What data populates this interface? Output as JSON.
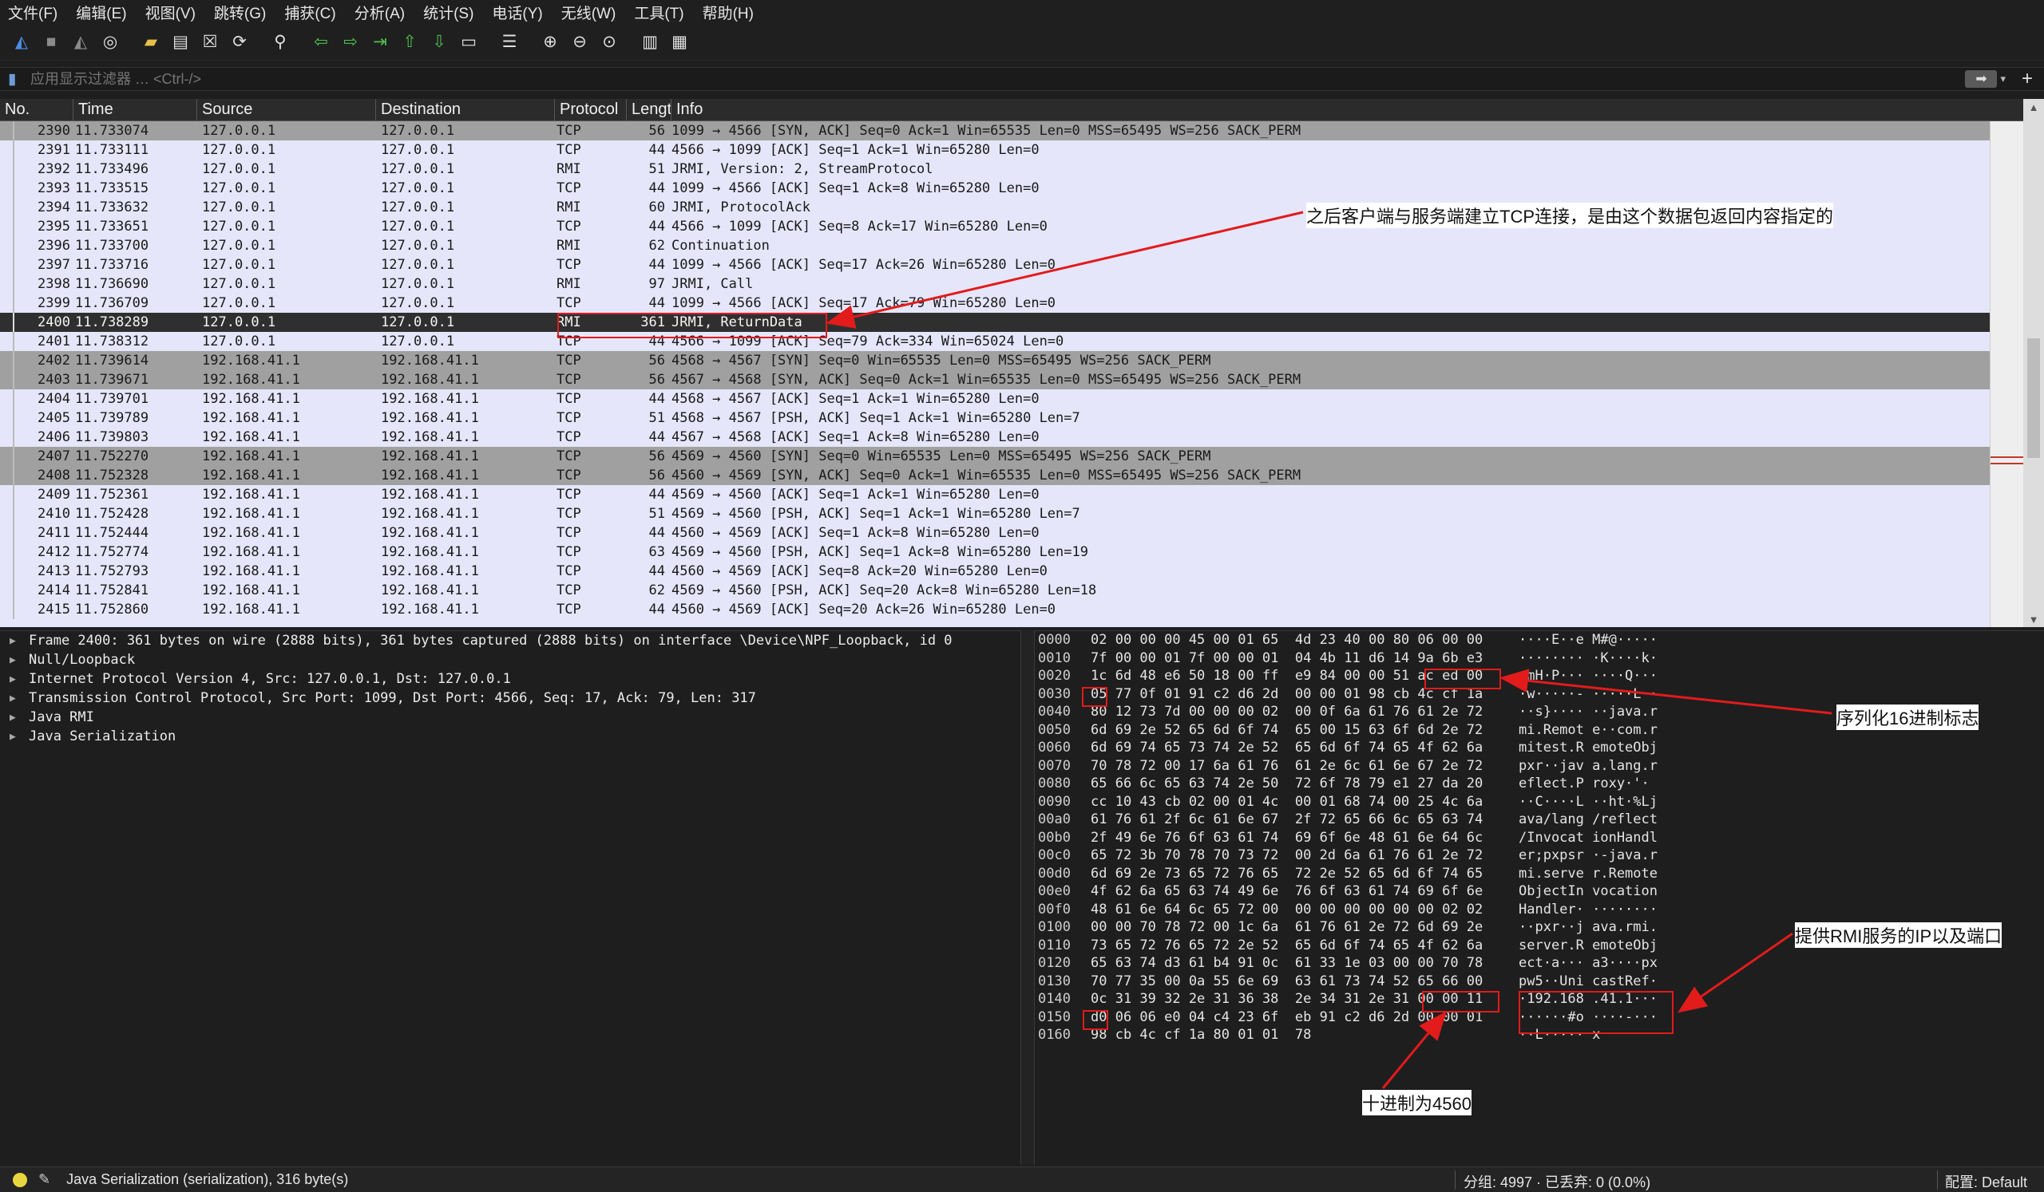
{
  "menu": [
    "文件(F)",
    "编辑(E)",
    "视图(V)",
    "跳转(G)",
    "捕获(C)",
    "分析(A)",
    "统计(S)",
    "电话(Y)",
    "无线(W)",
    "工具(T)",
    "帮助(H)"
  ],
  "toolbar": {
    "icons": [
      {
        "name": "shark-fin-start-icon",
        "glyph": "◭",
        "color": "#4b8de0"
      },
      {
        "name": "stop-capture-icon",
        "glyph": "■",
        "color": "#8a8a8a"
      },
      {
        "name": "restart-capture-icon",
        "glyph": "◭",
        "color": "#8a8a8a"
      },
      {
        "name": "capture-options-icon",
        "glyph": "◎",
        "color": "#e0e0e0"
      },
      {
        "name": "open-file-icon",
        "glyph": "▰",
        "color": "#e8c048"
      },
      {
        "name": "save-file-icon",
        "glyph": "▤",
        "color": "#e0e0e0"
      },
      {
        "name": "close-file-icon",
        "glyph": "☒",
        "color": "#e0e0e0"
      },
      {
        "name": "reload-file-icon",
        "glyph": "⟳",
        "color": "#e0e0e0"
      },
      {
        "name": "find-packet-icon",
        "glyph": "⚲",
        "color": "#e0e0e0"
      },
      {
        "name": "go-back-icon",
        "glyph": "⇦",
        "color": "#4fc04f"
      },
      {
        "name": "go-forward-icon",
        "glyph": "⇨",
        "color": "#4fc04f"
      },
      {
        "name": "go-to-packet-icon",
        "glyph": "⇥",
        "color": "#4fc04f"
      },
      {
        "name": "first-packet-icon",
        "glyph": "⇧",
        "color": "#4fc04f"
      },
      {
        "name": "last-packet-icon",
        "glyph": "⇩",
        "color": "#4fc04f"
      },
      {
        "name": "auto-scroll-icon",
        "glyph": "▭",
        "color": "#e0e0e0"
      },
      {
        "name": "colorize-icon",
        "glyph": "☰",
        "color": "#e0e0e0"
      },
      {
        "name": "zoom-in-icon",
        "glyph": "⊕",
        "color": "#e0e0e0"
      },
      {
        "name": "zoom-out-icon",
        "glyph": "⊖",
        "color": "#e0e0e0"
      },
      {
        "name": "zoom-normal-icon",
        "glyph": "⊙",
        "color": "#e0e0e0"
      },
      {
        "name": "resize-columns-icon",
        "glyph": "▥",
        "color": "#e0e0e0"
      },
      {
        "name": "layout-icon",
        "glyph": "▦",
        "color": "#e0e0e0"
      }
    ]
  },
  "filter": {
    "placeholder": "应用显示过滤器 … <Ctrl-/>",
    "apply_glyph": "➡",
    "dropdown_glyph": "▾",
    "add_glyph": "+"
  },
  "packet_list": {
    "columns": [
      "No.",
      "Time",
      "Source",
      "Destination",
      "Protocol",
      "Length",
      "Info"
    ],
    "rows": [
      {
        "no": "2390",
        "time": "11.733074",
        "src": "127.0.0.1",
        "dst": "127.0.0.1",
        "proto": "TCP",
        "len": "56",
        "info": "1099 → 4566 [SYN, ACK] Seq=0 Ack=1 Win=65535 Len=0 MSS=65495 WS=256 SACK_PERM",
        "style": "syn"
      },
      {
        "no": "2391",
        "time": "11.733111",
        "src": "127.0.0.1",
        "dst": "127.0.0.1",
        "proto": "TCP",
        "len": "44",
        "info": "4566 → 1099 [ACK] Seq=1 Ack=1 Win=65280 Len=0",
        "style": ""
      },
      {
        "no": "2392",
        "time": "11.733496",
        "src": "127.0.0.1",
        "dst": "127.0.0.1",
        "proto": "RMI",
        "len": "51",
        "info": "JRMI, Version: 2, StreamProtocol",
        "style": ""
      },
      {
        "no": "2393",
        "time": "11.733515",
        "src": "127.0.0.1",
        "dst": "127.0.0.1",
        "proto": "TCP",
        "len": "44",
        "info": "1099 → 4566 [ACK] Seq=1 Ack=8 Win=65280 Len=0",
        "style": ""
      },
      {
        "no": "2394",
        "time": "11.733632",
        "src": "127.0.0.1",
        "dst": "127.0.0.1",
        "proto": "RMI",
        "len": "60",
        "info": "JRMI, ProtocolAck",
        "style": ""
      },
      {
        "no": "2395",
        "time": "11.733651",
        "src": "127.0.0.1",
        "dst": "127.0.0.1",
        "proto": "TCP",
        "len": "44",
        "info": "4566 → 1099 [ACK] Seq=8 Ack=17 Win=65280 Len=0",
        "style": ""
      },
      {
        "no": "2396",
        "time": "11.733700",
        "src": "127.0.0.1",
        "dst": "127.0.0.1",
        "proto": "RMI",
        "len": "62",
        "info": "Continuation",
        "style": ""
      },
      {
        "no": "2397",
        "time": "11.733716",
        "src": "127.0.0.1",
        "dst": "127.0.0.1",
        "proto": "TCP",
        "len": "44",
        "info": "1099 → 4566 [ACK] Seq=17 Ack=26 Win=65280 Len=0",
        "style": ""
      },
      {
        "no": "2398",
        "time": "11.736690",
        "src": "127.0.0.1",
        "dst": "127.0.0.1",
        "proto": "RMI",
        "len": "97",
        "info": "JRMI, Call",
        "style": ""
      },
      {
        "no": "2399",
        "time": "11.736709",
        "src": "127.0.0.1",
        "dst": "127.0.0.1",
        "proto": "TCP",
        "len": "44",
        "info": "1099 → 4566 [ACK] Seq=17 Ack=79 Win=65280 Len=0",
        "style": ""
      },
      {
        "no": "2400",
        "time": "11.738289",
        "src": "127.0.0.1",
        "dst": "127.0.0.1",
        "proto": "RMI",
        "len": "361",
        "info": "JRMI, ReturnData",
        "style": "sel"
      },
      {
        "no": "2401",
        "time": "11.738312",
        "src": "127.0.0.1",
        "dst": "127.0.0.1",
        "proto": "TCP",
        "len": "44",
        "info": "4566 → 1099 [ACK] Seq=79 Ack=334 Win=65024 Len=0",
        "style": ""
      },
      {
        "no": "2402",
        "time": "11.739614",
        "src": "192.168.41.1",
        "dst": "192.168.41.1",
        "proto": "TCP",
        "len": "56",
        "info": "4568 → 4567 [SYN] Seq=0 Win=65535 Len=0 MSS=65495 WS=256 SACK_PERM",
        "style": "syn"
      },
      {
        "no": "2403",
        "time": "11.739671",
        "src": "192.168.41.1",
        "dst": "192.168.41.1",
        "proto": "TCP",
        "len": "56",
        "info": "4567 → 4568 [SYN, ACK] Seq=0 Ack=1 Win=65535 Len=0 MSS=65495 WS=256 SACK_PERM",
        "style": "syn"
      },
      {
        "no": "2404",
        "time": "11.739701",
        "src": "192.168.41.1",
        "dst": "192.168.41.1",
        "proto": "TCP",
        "len": "44",
        "info": "4568 → 4567 [ACK] Seq=1 Ack=1 Win=65280 Len=0",
        "style": ""
      },
      {
        "no": "2405",
        "time": "11.739789",
        "src": "192.168.41.1",
        "dst": "192.168.41.1",
        "proto": "TCP",
        "len": "51",
        "info": "4568 → 4567 [PSH, ACK] Seq=1 Ack=1 Win=65280 Len=7",
        "style": ""
      },
      {
        "no": "2406",
        "time": "11.739803",
        "src": "192.168.41.1",
        "dst": "192.168.41.1",
        "proto": "TCP",
        "len": "44",
        "info": "4567 → 4568 [ACK] Seq=1 Ack=8 Win=65280 Len=0",
        "style": ""
      },
      {
        "no": "2407",
        "time": "11.752270",
        "src": "192.168.41.1",
        "dst": "192.168.41.1",
        "proto": "TCP",
        "len": "56",
        "info": "4569 → 4560 [SYN] Seq=0 Win=65535 Len=0 MSS=65495 WS=256 SACK_PERM",
        "style": "syn"
      },
      {
        "no": "2408",
        "time": "11.752328",
        "src": "192.168.41.1",
        "dst": "192.168.41.1",
        "proto": "TCP",
        "len": "56",
        "info": "4560 → 4569 [SYN, ACK] Seq=0 Ack=1 Win=65535 Len=0 MSS=65495 WS=256 SACK_PERM",
        "style": "syn"
      },
      {
        "no": "2409",
        "time": "11.752361",
        "src": "192.168.41.1",
        "dst": "192.168.41.1",
        "proto": "TCP",
        "len": "44",
        "info": "4569 → 4560 [ACK] Seq=1 Ack=1 Win=65280 Len=0",
        "style": ""
      },
      {
        "no": "2410",
        "time": "11.752428",
        "src": "192.168.41.1",
        "dst": "192.168.41.1",
        "proto": "TCP",
        "len": "51",
        "info": "4569 → 4560 [PSH, ACK] Seq=1 Ack=1 Win=65280 Len=7",
        "style": ""
      },
      {
        "no": "2411",
        "time": "11.752444",
        "src": "192.168.41.1",
        "dst": "192.168.41.1",
        "proto": "TCP",
        "len": "44",
        "info": "4560 → 4569 [ACK] Seq=1 Ack=8 Win=65280 Len=0",
        "style": ""
      },
      {
        "no": "2412",
        "time": "11.752774",
        "src": "192.168.41.1",
        "dst": "192.168.41.1",
        "proto": "TCP",
        "len": "63",
        "info": "4569 → 4560 [PSH, ACK] Seq=1 Ack=8 Win=65280 Len=19",
        "style": ""
      },
      {
        "no": "2413",
        "time": "11.752793",
        "src": "192.168.41.1",
        "dst": "192.168.41.1",
        "proto": "TCP",
        "len": "44",
        "info": "4560 → 4569 [ACK] Seq=8 Ack=20 Win=65280 Len=0",
        "style": ""
      },
      {
        "no": "2414",
        "time": "11.752841",
        "src": "192.168.41.1",
        "dst": "192.168.41.1",
        "proto": "TCP",
        "len": "62",
        "info": "4569 → 4560 [PSH, ACK] Seq=20 Ack=8 Win=65280 Len=18",
        "style": ""
      },
      {
        "no": "2415",
        "time": "11.752860",
        "src": "192.168.41.1",
        "dst": "192.168.41.1",
        "proto": "TCP",
        "len": "44",
        "info": "4560 → 4569 [ACK] Seq=20 Ack=26 Win=65280 Len=0",
        "style": ""
      }
    ]
  },
  "details": [
    "Frame 2400: 361 bytes on wire (2888 bits), 361 bytes captured (2888 bits) on interface \\Device\\NPF_Loopback, id 0",
    "Null/Loopback",
    "Internet Protocol Version 4, Src: 127.0.0.1, Dst: 127.0.0.1",
    "Transmission Control Protocol, Src Port: 1099, Dst Port: 4566, Seq: 17, Ack: 79, Len: 317",
    "Java RMI",
    "Java Serialization"
  ],
  "hex": [
    {
      "off": "0000",
      "bytes": "02 00 00 00 45 00 01 65  4d 23 40 00 80 06 00 00",
      "ascii": "····E··e M#@·····"
    },
    {
      "off": "0010",
      "bytes": "7f 00 00 01 7f 00 00 01  04 4b 11 d6 14 9a 6b e3",
      "ascii": "········ ·K····k·"
    },
    {
      "off": "0020",
      "bytes": "1c 6d 48 e6 50 18 00 ff  e9 84 00 00 51 ac ed 00",
      "ascii": "·mH·P··· ····Q···"
    },
    {
      "off": "0030",
      "bytes": "05 77 0f 01 91 c2 d6 2d  00 00 01 98 cb 4c cf 1a",
      "ascii": "·w·····- ·····L··"
    },
    {
      "off": "0040",
      "bytes": "80 12 73 7d 00 00 00 02  00 0f 6a 61 76 61 2e 72",
      "ascii": "··s}···· ··java.r"
    },
    {
      "off": "0050",
      "bytes": "6d 69 2e 52 65 6d 6f 74  65 00 15 63 6f 6d 2e 72",
      "ascii": "mi.Remot e··com.r"
    },
    {
      "off": "0060",
      "bytes": "6d 69 74 65 73 74 2e 52  65 6d 6f 74 65 4f 62 6a",
      "ascii": "mitest.R emoteObj"
    },
    {
      "off": "0070",
      "bytes": "70 78 72 00 17 6a 61 76  61 2e 6c 61 6e 67 2e 72",
      "ascii": "pxr··jav a.lang.r"
    },
    {
      "off": "0080",
      "bytes": "65 66 6c 65 63 74 2e 50  72 6f 78 79 e1 27 da 20",
      "ascii": "eflect.P roxy·'· "
    },
    {
      "off": "0090",
      "bytes": "cc 10 43 cb 02 00 01 4c  00 01 68 74 00 25 4c 6a",
      "ascii": "··C····L ··ht·%Lj"
    },
    {
      "off": "00a0",
      "bytes": "61 76 61 2f 6c 61 6e 67  2f 72 65 66 6c 65 63 74",
      "ascii": "ava/lang /reflect"
    },
    {
      "off": "00b0",
      "bytes": "2f 49 6e 76 6f 63 61 74  69 6f 6e 48 61 6e 64 6c",
      "ascii": "/Invocat ionHandl"
    },
    {
      "off": "00c0",
      "bytes": "65 72 3b 70 78 70 73 72  00 2d 6a 61 76 61 2e 72",
      "ascii": "er;pxpsr ·-java.r"
    },
    {
      "off": "00d0",
      "bytes": "6d 69 2e 73 65 72 76 65  72 2e 52 65 6d 6f 74 65",
      "ascii": "mi.serve r.Remote"
    },
    {
      "off": "00e0",
      "bytes": "4f 62 6a 65 63 74 49 6e  76 6f 63 61 74 69 6f 6e",
      "ascii": "ObjectIn vocation"
    },
    {
      "off": "00f0",
      "bytes": "48 61 6e 64 6c 65 72 00  00 00 00 00 00 00 02 02",
      "ascii": "Handler· ········"
    },
    {
      "off": "0100",
      "bytes": "00 00 70 78 72 00 1c 6a  61 76 61 2e 72 6d 69 2e",
      "ascii": "··pxr··j ava.rmi."
    },
    {
      "off": "0110",
      "bytes": "73 65 72 76 65 72 2e 52  65 6d 6f 74 65 4f 62 6a",
      "ascii": "server.R emoteObj"
    },
    {
      "off": "0120",
      "bytes": "65 63 74 d3 61 b4 91 0c  61 33 1e 03 00 00 70 78",
      "ascii": "ect·a··· a3····px"
    },
    {
      "off": "0130",
      "bytes": "70 77 35 00 0a 55 6e 69  63 61 73 74 52 65 66 00",
      "ascii": "pw5··Uni castRef·"
    },
    {
      "off": "0140",
      "bytes": "0c 31 39 32 2e 31 36 38  2e 34 31 2e 31 00 00 11",
      "ascii": "·192.168 .41.1···"
    },
    {
      "off": "0150",
      "bytes": "d0 06 06 e0 04 c4 23 6f  eb 91 c2 d6 2d 00 00 01",
      "ascii": "······#o ····-···"
    },
    {
      "off": "0160",
      "bytes": "98 cb 4c cf 1a 80 01 01  78",
      "ascii": "··L····· x"
    }
  ],
  "annotations": {
    "return_data_note": "之后客户端与服务端建立TCP连接，是由这个数据包返回内容指定的",
    "serial_magic_note": "序列化16进制标志",
    "rmi_ip_port_note": "提供RMI服务的IP以及端口",
    "decimal_port_note": "十进制为4560"
  },
  "status": {
    "edit_glyph": "✎",
    "field_text": "Java Serialization (serialization), 316 byte(s)",
    "packets_text": "分组: 4997 · 已丢弃: 0 (0.0%)",
    "profile_text": "配置: Default"
  },
  "colors": {
    "annotation_red": "#e21b1b",
    "syn_row": "#a0a0a0",
    "selected_row": "#2f2f2f",
    "list_bg": "#e6e6fb"
  }
}
